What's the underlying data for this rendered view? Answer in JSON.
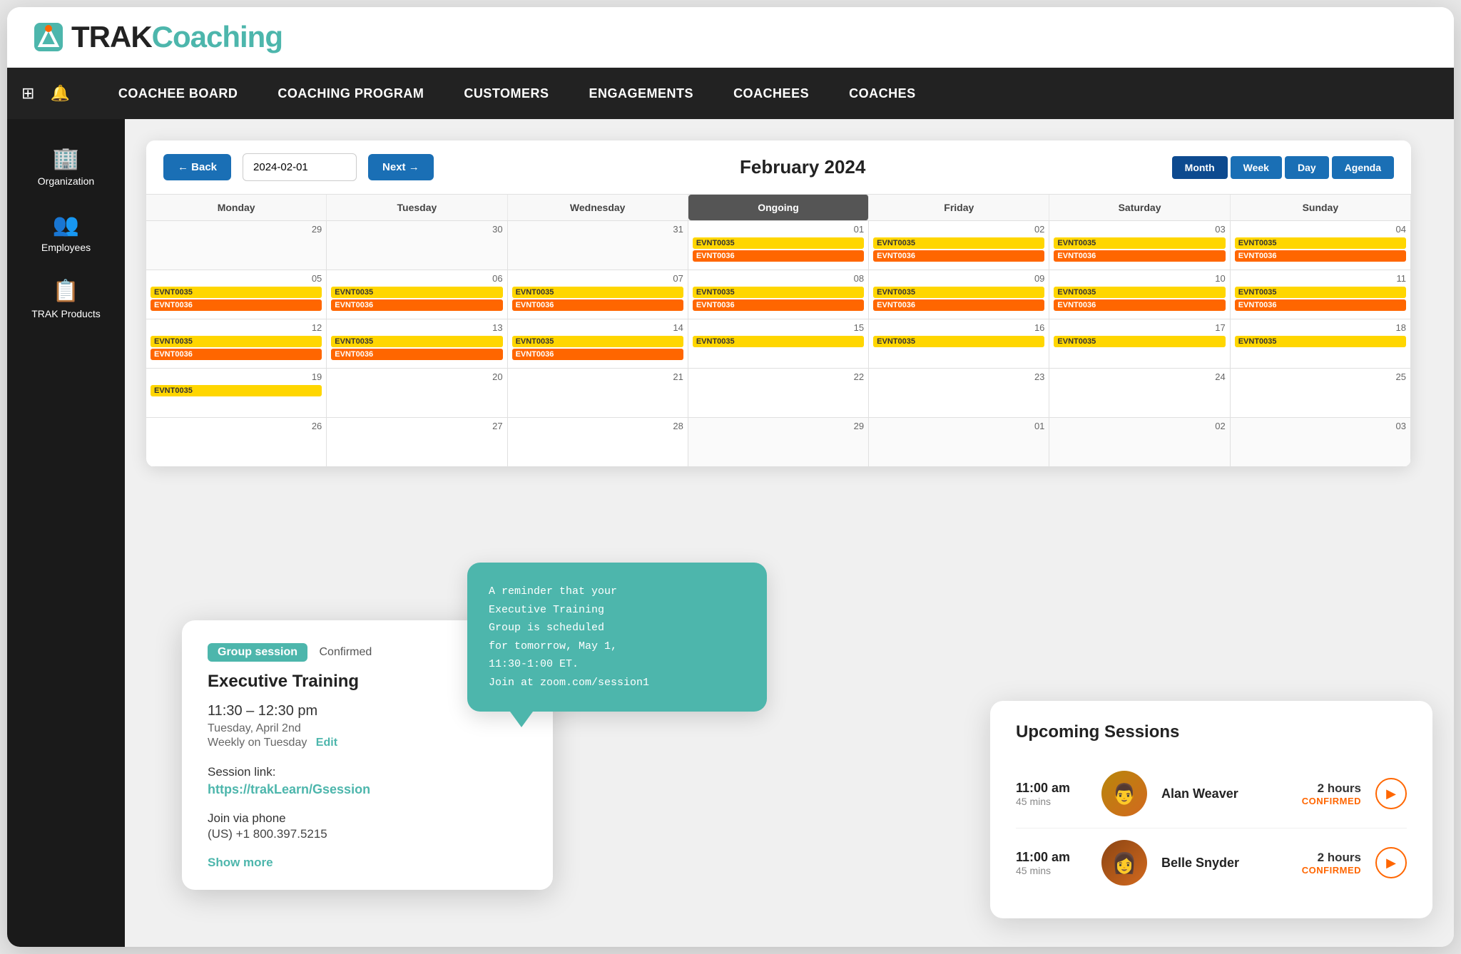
{
  "logo": {
    "trak": "TRAK",
    "coaching": "Coaching"
  },
  "topnav": {
    "items": [
      {
        "label": "COACHEE BOARD",
        "id": "coachee-board"
      },
      {
        "label": "COACHING PROGRAM",
        "id": "coaching-program"
      },
      {
        "label": "CUSTOMERS",
        "id": "customers"
      },
      {
        "label": "ENGAGEMENTS",
        "id": "engagements"
      },
      {
        "label": "COACHEES",
        "id": "coachees"
      },
      {
        "label": "COACHES",
        "id": "coaches"
      }
    ]
  },
  "sidebar": {
    "items": [
      {
        "label": "Organization",
        "icon": "🏢",
        "id": "organization"
      },
      {
        "label": "Employees",
        "icon": "👥",
        "id": "employees"
      },
      {
        "label": "TRAK Products",
        "icon": "📋",
        "id": "trak-products"
      }
    ]
  },
  "calendar": {
    "title": "February 2024",
    "date_value": "2024-02-01",
    "back_label": "← Back",
    "next_label": "Next →",
    "view_buttons": [
      "Month",
      "Week",
      "Day",
      "Agenda"
    ],
    "active_view": "Month",
    "day_headers": [
      "Monday",
      "Tuesday",
      "Wednesday",
      "Ongoing",
      "Friday",
      "Saturday",
      "Sunday"
    ],
    "weeks": [
      {
        "cells": [
          {
            "num": "29",
            "events": []
          },
          {
            "num": "30",
            "events": []
          },
          {
            "num": "31",
            "events": []
          },
          {
            "num": "01",
            "events": [
              "EVNT0035",
              "EVNT0036"
            ]
          },
          {
            "num": "02",
            "events": [
              "EVNT0035",
              "EVNT0036"
            ]
          },
          {
            "num": "03",
            "events": [
              "EVNT0035",
              "EVNT0036"
            ]
          },
          {
            "num": "04",
            "events": [
              "EVNT0035",
              "EVNT0036"
            ]
          }
        ]
      },
      {
        "cells": [
          {
            "num": "05",
            "events": [
              "EVNT0035",
              "EVNT0036"
            ]
          },
          {
            "num": "06",
            "events": [
              "EVNT0035",
              "EVNT0036"
            ]
          },
          {
            "num": "07",
            "events": [
              "EVNT0035",
              "EVNT0036"
            ]
          },
          {
            "num": "08",
            "events": [
              "EVNT0035",
              "EVNT0036"
            ]
          },
          {
            "num": "09",
            "events": [
              "EVNT0035",
              "EVNT0036"
            ]
          },
          {
            "num": "10",
            "events": [
              "EVNT0035",
              "EVNT0036"
            ]
          },
          {
            "num": "11",
            "events": [
              "EVNT0035",
              "EVNT0036"
            ]
          }
        ]
      },
      {
        "cells": [
          {
            "num": "12",
            "events": [
              "EVNT0035",
              "EVNT0036"
            ]
          },
          {
            "num": "13",
            "events": [
              "EVNT0035",
              "EVNT0036"
            ]
          },
          {
            "num": "14",
            "events": [
              "EVNT0035",
              "EVNT0036"
            ]
          },
          {
            "num": "15",
            "events": [
              "EVNT0035"
            ]
          },
          {
            "num": "16",
            "events": [
              "EVNT0035"
            ]
          },
          {
            "num": "17",
            "events": [
              "EVNT0035"
            ]
          },
          {
            "num": "18",
            "events": [
              "EVNT0035"
            ]
          }
        ]
      },
      {
        "cells": [
          {
            "num": "19",
            "events": [
              "EVNT0035"
            ]
          },
          {
            "num": "20",
            "events": []
          },
          {
            "num": "21",
            "events": []
          },
          {
            "num": "22",
            "events": []
          },
          {
            "num": "23",
            "events": []
          },
          {
            "num": "24",
            "events": []
          },
          {
            "num": "25",
            "events": []
          }
        ]
      },
      {
        "cells": [
          {
            "num": "26",
            "events": []
          },
          {
            "num": "27",
            "events": []
          },
          {
            "num": "28",
            "events": []
          },
          {
            "num": "29",
            "events": []
          },
          {
            "num": "01",
            "events": []
          },
          {
            "num": "02",
            "events": []
          },
          {
            "num": "03",
            "events": []
          }
        ]
      }
    ]
  },
  "group_session": {
    "badge_label": "Group session",
    "status_label": "Confirmed",
    "title": "Executive Training",
    "time": "11:30 – 12:30 pm",
    "date": "Tuesday, April 2nd",
    "recurrence": "Weekly on Tuesday",
    "edit_label": "Edit",
    "session_link_label": "Session link:",
    "session_link": "https://trakLearn/Gsession",
    "phone_label": "Join via phone",
    "phone_number": "(US) +1 800.397.5215",
    "show_more_label": "Show more"
  },
  "reminder": {
    "text": "A reminder that your\nExecutive Training\nGroup is scheduled\nfor tomorrow, May 1,\n11:30-1:00 ET.\nJoin at zoom.com/session1"
  },
  "upcoming_sessions": {
    "title": "Upcoming Sessions",
    "sessions": [
      {
        "time": "11:00 am",
        "duration": "45 mins",
        "name": "Alan Weaver",
        "hours": "2 hours",
        "confirmed": "CONFIRMED",
        "avatar": "man"
      },
      {
        "time": "11:00 am",
        "duration": "45 mins",
        "name": "Belle Snyder",
        "hours": "2 hours",
        "confirmed": "CONFIRMED",
        "avatar": "woman"
      }
    ]
  }
}
